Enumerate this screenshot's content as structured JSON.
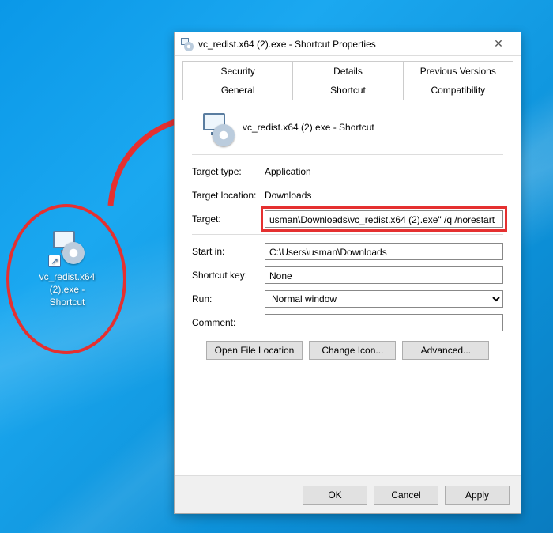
{
  "desktop_icon": {
    "label_line1": "vc_redist.x64",
    "label_line2": "(2).exe -",
    "label_line3": "Shortcut"
  },
  "dialog": {
    "title": "vc_redist.x64 (2).exe - Shortcut Properties",
    "tabs_row1": {
      "security": "Security",
      "details": "Details",
      "previous": "Previous Versions"
    },
    "tabs_row2": {
      "general": "General",
      "shortcut": "Shortcut",
      "compat": "Compatibility"
    },
    "header_label": "vc_redist.x64 (2).exe - Shortcut",
    "fields": {
      "target_type_label": "Target type:",
      "target_type_value": "Application",
      "target_location_label": "Target location:",
      "target_location_value": "Downloads",
      "target_label": "Target:",
      "target_value": "usman\\Downloads\\vc_redist.x64 (2).exe\" /q /norestart",
      "start_in_label": "Start in:",
      "start_in_value": "C:\\Users\\usman\\Downloads",
      "shortcut_key_label": "Shortcut key:",
      "shortcut_key_value": "None",
      "run_label": "Run:",
      "run_value": "Normal window",
      "comment_label": "Comment:",
      "comment_value": ""
    },
    "buttons": {
      "open_location": "Open File Location",
      "change_icon": "Change Icon...",
      "advanced": "Advanced..."
    },
    "dialog_buttons": {
      "ok": "OK",
      "cancel": "Cancel",
      "apply": "Apply"
    }
  }
}
